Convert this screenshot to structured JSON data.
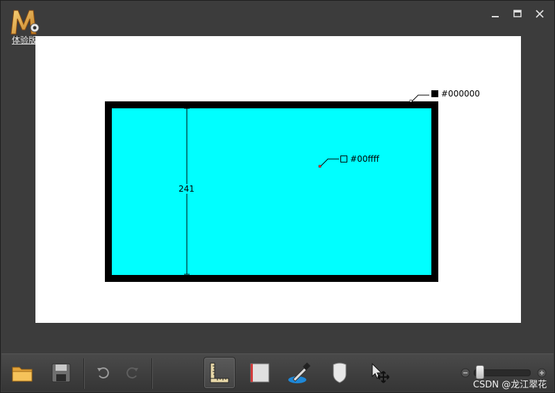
{
  "app": {
    "edition_label": "体验版"
  },
  "window_controls": {
    "minimize": "minimize-icon",
    "maximize": "maximize-icon",
    "close": "close-icon"
  },
  "canvas": {
    "outer_color": "#000000",
    "inner_color": "#00ffff",
    "measurement": "241",
    "outer_color_tag": "#000000",
    "inner_color_tag": "#00ffff"
  },
  "toolbar": {
    "tools": [
      {
        "name": "open-folder-icon"
      },
      {
        "name": "save-disk-icon"
      },
      {
        "name": "undo-icon"
      },
      {
        "name": "redo-icon"
      },
      {
        "name": "ruler-icon",
        "active": true
      },
      {
        "name": "rectangle-icon"
      },
      {
        "name": "color-picker-icon"
      },
      {
        "name": "marker-icon"
      },
      {
        "name": "move-cursor-icon"
      }
    ],
    "zoom": {
      "level": 0.1
    }
  },
  "watermark": "CSDN @龙江翠花"
}
